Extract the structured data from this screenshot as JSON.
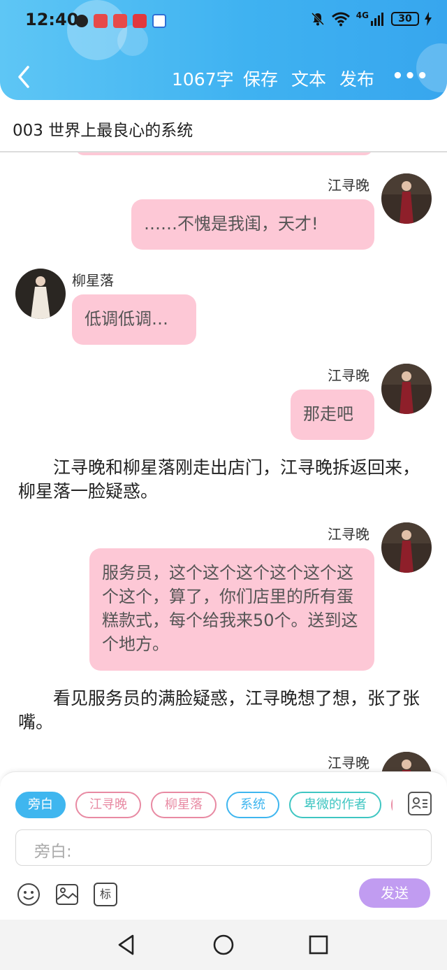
{
  "status_bar": {
    "time": "12:40",
    "network": "4G",
    "battery": "30"
  },
  "toolbar": {
    "word_count": "1067字",
    "save": "保存",
    "text": "文本",
    "publish": "发布",
    "more": "•••"
  },
  "document": {
    "title": "003 世界上最良心的系统"
  },
  "messages": [
    {
      "type": "right",
      "name": "江寻晚",
      "text": "……不愧是我闺，天才!"
    },
    {
      "type": "left",
      "name": "柳星落",
      "text": "低调低调…"
    },
    {
      "type": "right",
      "name": "江寻晚",
      "text": "那走吧"
    },
    {
      "type": "narration",
      "text": "江寻晚和柳星落刚走出店门，江寻晚拆返回来，柳星落一脸疑惑。"
    },
    {
      "type": "right",
      "name": "江寻晚",
      "text": "服务员，这个这个这个这个这个这个这个，算了，你们店里的所有蛋糕款式，每个给我来50个。送到这个地方。"
    },
    {
      "type": "narration",
      "text": "看见服务员的满脸疑惑，江寻晚想了想，张了张嘴。"
    },
    {
      "type": "right",
      "name": "江寻晚",
      "text": ""
    }
  ],
  "roles": [
    {
      "label": "旁白",
      "color": "#3fb6ef",
      "active": true
    },
    {
      "label": "江寻晚",
      "color": "#e88aa3",
      "active": false
    },
    {
      "label": "柳星落",
      "color": "#e88aa3",
      "active": false
    },
    {
      "label": "系统",
      "color": "#3fb6ef",
      "active": false
    },
    {
      "label": "卑微的作者",
      "color": "#3fc6c2",
      "active": false
    }
  ],
  "composer": {
    "placeholder": "旁白:",
    "send_label": "发送",
    "tag_label": "标"
  },
  "colors": {
    "header_accent": "#3fb2f1",
    "bubble": "#fdc8d6",
    "send_button": "#c19cf1"
  }
}
